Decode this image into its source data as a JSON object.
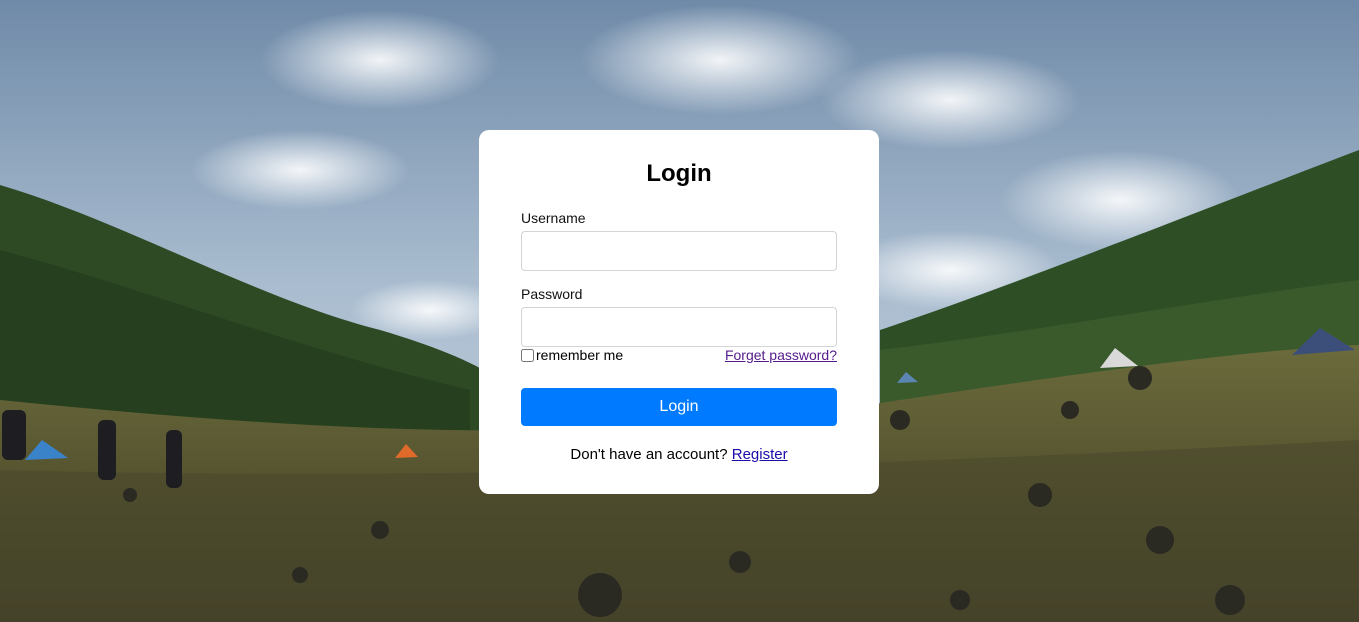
{
  "background": {
    "description_icon": "mountain-landscape-image",
    "sky_color": "#8fa6c0",
    "hill_color": "#2f4a26",
    "ground_color": "#5a5a33"
  },
  "login": {
    "title": "Login",
    "username_label": "Username",
    "username_value": "",
    "password_label": "Password",
    "password_value": "",
    "remember_label": "remember me",
    "remember_checked": false,
    "forgot_link": "Forget password?",
    "submit_label": "Login",
    "footer_text": "Don't have an account?",
    "register_link": "Register",
    "accent_color": "#007bff"
  }
}
